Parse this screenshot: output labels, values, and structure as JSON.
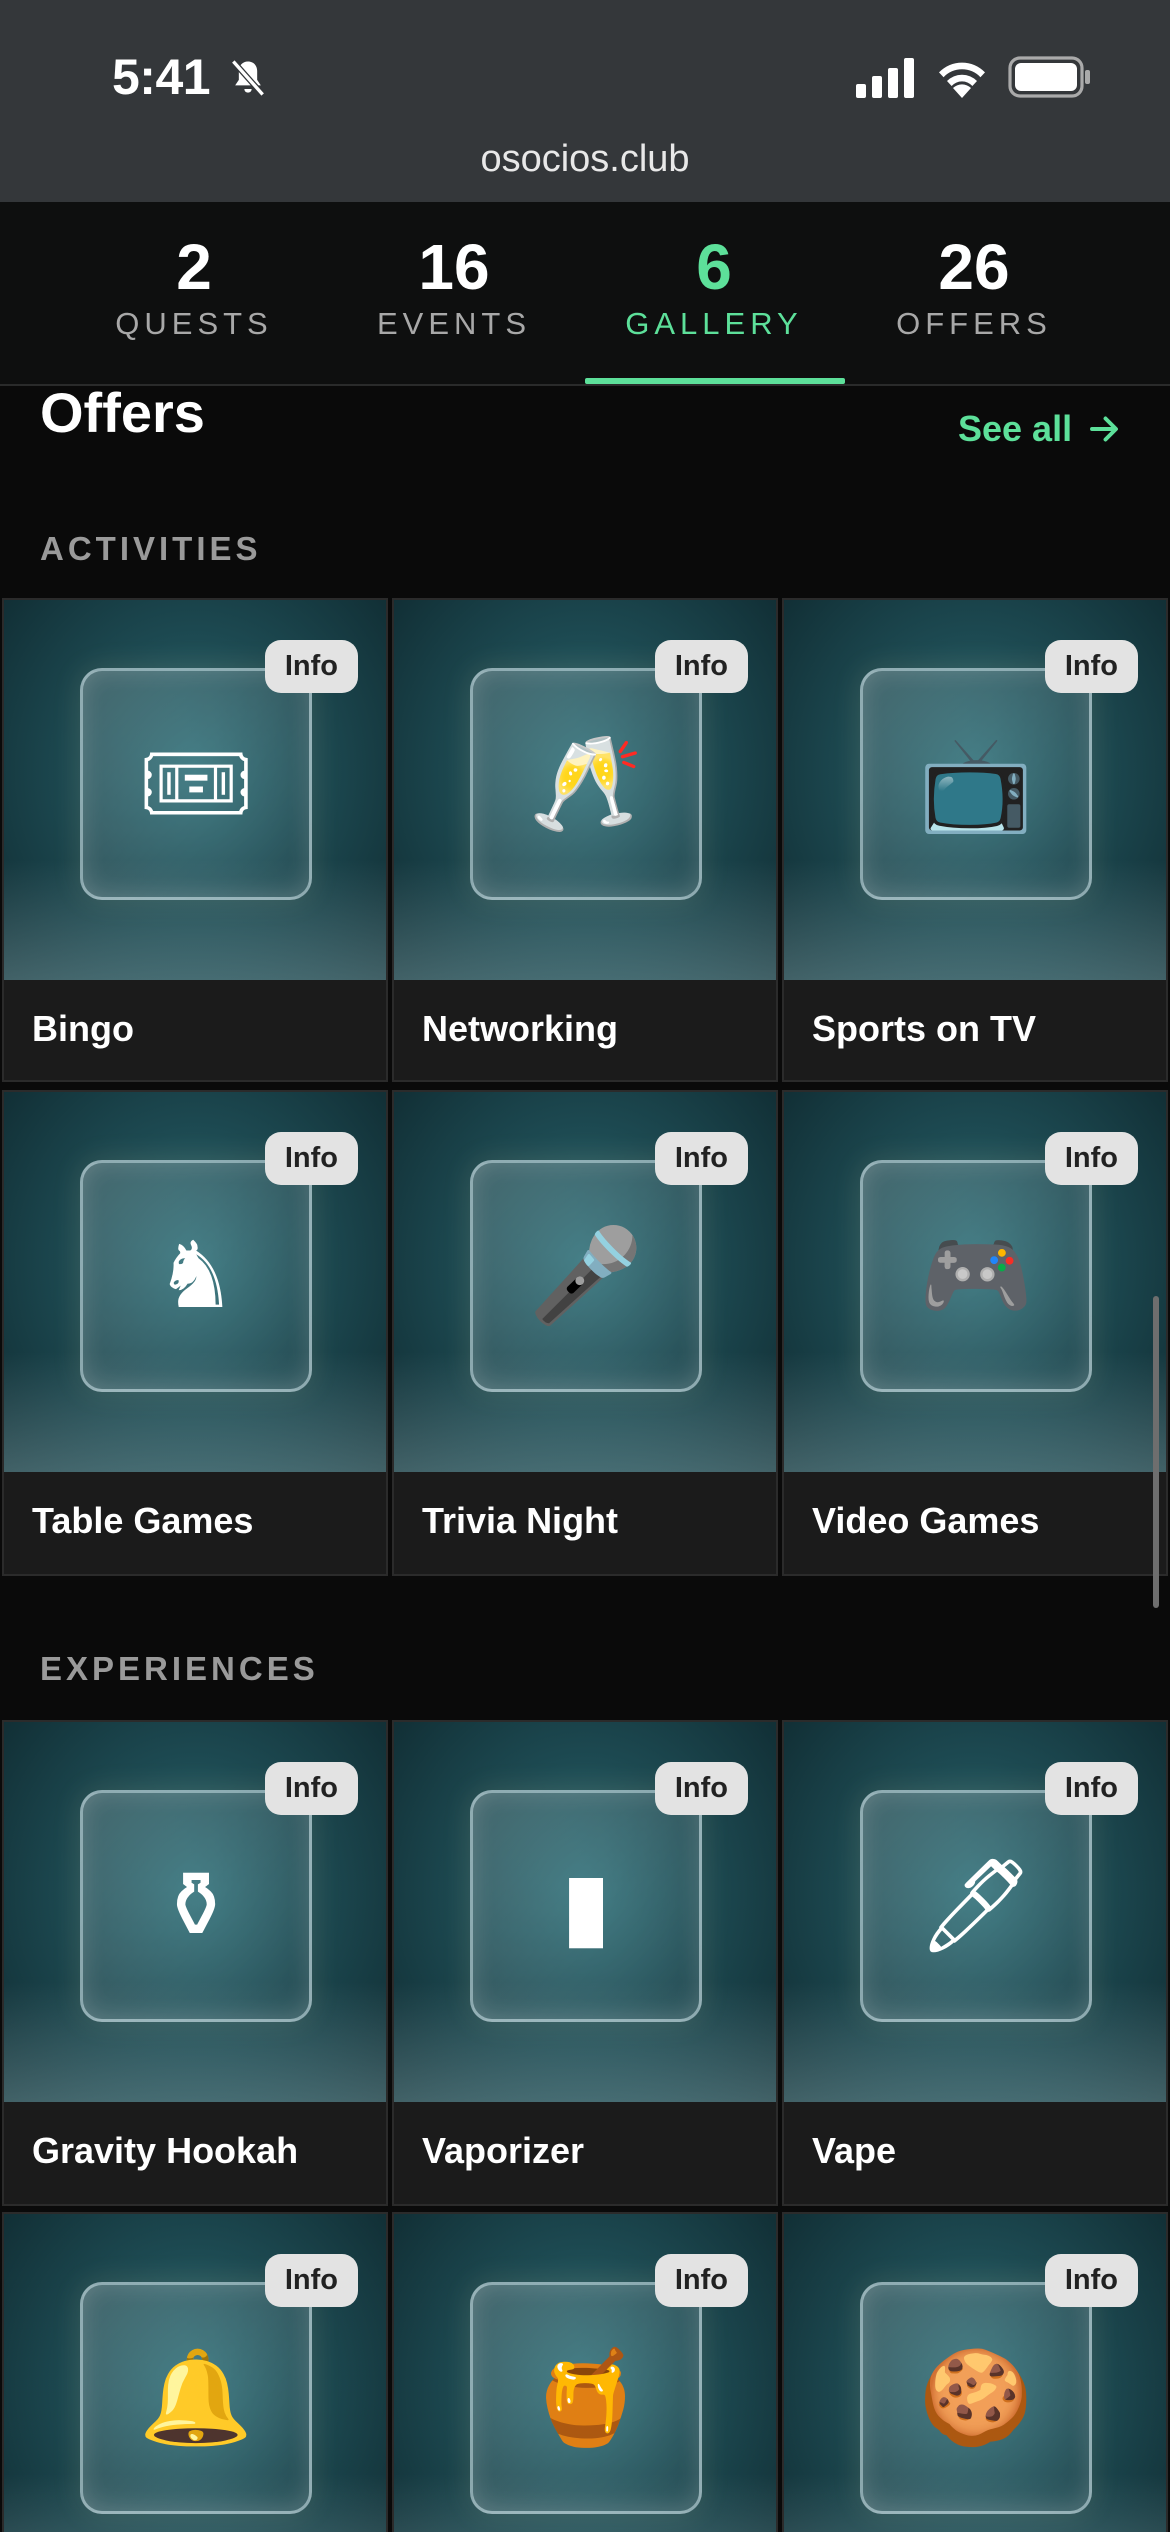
{
  "status_bar": {
    "time": "5:41"
  },
  "browser": {
    "url": "osocios.club"
  },
  "stats": [
    {
      "num": "2",
      "label": "QUESTS"
    },
    {
      "num": "16",
      "label": "EVENTS"
    },
    {
      "num": "6",
      "label": "GALLERY"
    },
    {
      "num": "26",
      "label": "OFFERS"
    }
  ],
  "active_tab": "GALLERY",
  "offers": {
    "title": "Offers",
    "see_all": "See all"
  },
  "sections": {
    "activities": {
      "label": "ACTIVITIES",
      "items": [
        {
          "title": "Bingo",
          "info": "Info",
          "icon": "bingo-card-icon"
        },
        {
          "title": "Networking",
          "info": "Info",
          "icon": "champagne-icon"
        },
        {
          "title": "Sports on TV",
          "info": "Info",
          "icon": "tv-field-icon"
        },
        {
          "title": "Table Games",
          "info": "Info",
          "icon": "chess-dice-icon"
        },
        {
          "title": "Trivia Night",
          "info": "Info",
          "icon": "microphone-icon"
        },
        {
          "title": "Video Games",
          "info": "Info",
          "icon": "gamepad-icon"
        }
      ]
    },
    "experiences": {
      "label": "EXPERIENCES",
      "items": [
        {
          "title": "Gravity Hookah",
          "info": "Info",
          "icon": "hookah-icon"
        },
        {
          "title": "Vaporizer",
          "info": "Info",
          "icon": "vaporizer-icon"
        },
        {
          "title": "Vape",
          "info": "Info",
          "icon": "vape-pen-icon"
        },
        {
          "title": "",
          "info": "Info",
          "icon": "desktop-vaporizer-icon"
        },
        {
          "title": "",
          "info": "Info",
          "icon": "honey-jar-icon"
        },
        {
          "title": "",
          "info": "Info",
          "icon": "cookies-icon"
        }
      ]
    }
  },
  "colors": {
    "accent": "#5de09a",
    "background": "#0a0a0a",
    "card": "#1b1b1b",
    "status_bar": "#34373a"
  }
}
